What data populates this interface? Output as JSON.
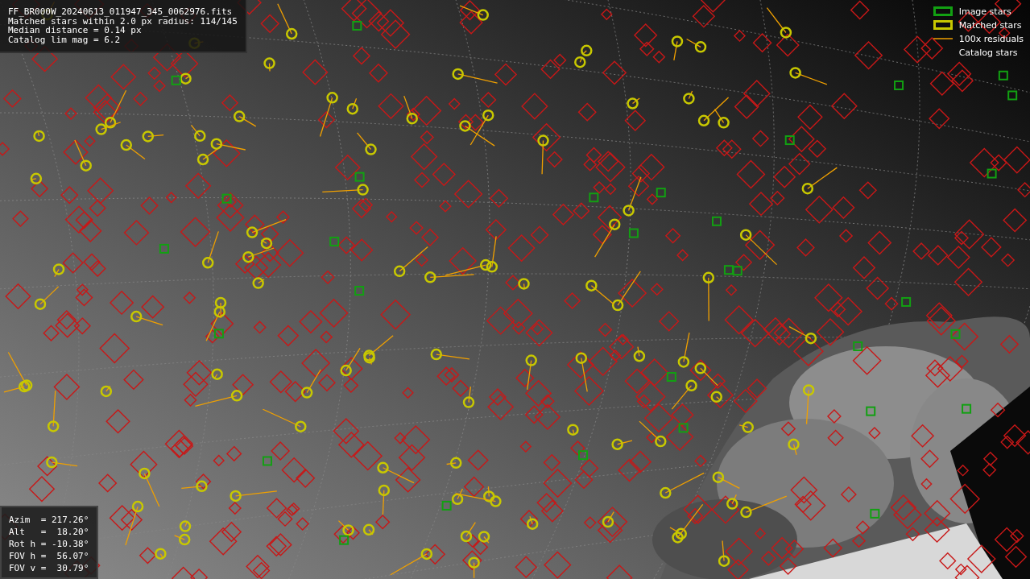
{
  "info": {
    "lines": [
      "FF_BR000W_20240613_011947_345_0062976.fits",
      "Matched stars within 2.0 px radius: 114/145",
      "Median distance = 0.14 px",
      "Catalog lim mag = 6.2"
    ]
  },
  "legend": [
    {
      "kind": "image",
      "label": "Image stars"
    },
    {
      "kind": "matched",
      "label": "Matched stars"
    },
    {
      "kind": "residual",
      "label": "100x residuals"
    },
    {
      "kind": "catalog",
      "label": "Catalog stars"
    }
  ],
  "pointing": {
    "lines": [
      "Azim  = 217.26°",
      "Alt   =  18.20°",
      "Rot h = -10.38°",
      "FOV h =  56.07°",
      "FOV v =  30.79°"
    ]
  }
}
